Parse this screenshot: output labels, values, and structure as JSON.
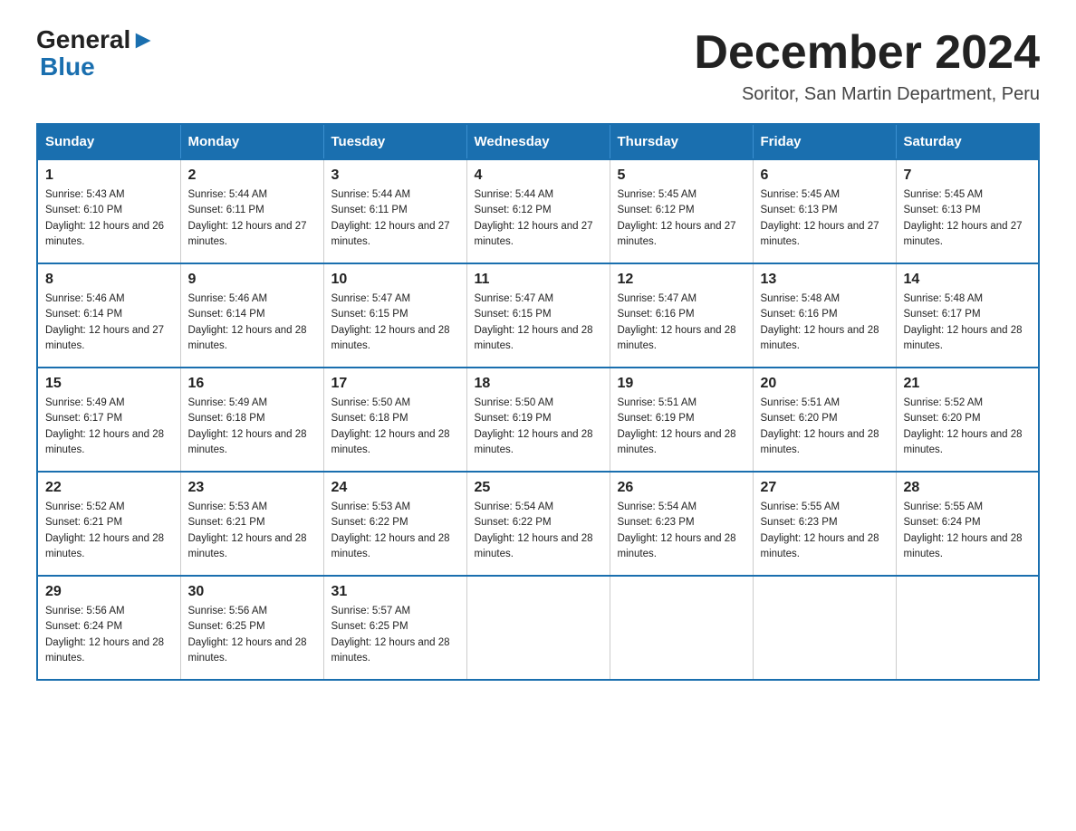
{
  "logo": {
    "text1": "General",
    "text2": "Blue"
  },
  "header": {
    "month": "December 2024",
    "location": "Soritor, San Martin Department, Peru"
  },
  "weekdays": [
    "Sunday",
    "Monday",
    "Tuesday",
    "Wednesday",
    "Thursday",
    "Friday",
    "Saturday"
  ],
  "weeks": [
    [
      {
        "day": "1",
        "sunrise": "5:43 AM",
        "sunset": "6:10 PM",
        "daylight": "12 hours and 26 minutes."
      },
      {
        "day": "2",
        "sunrise": "5:44 AM",
        "sunset": "6:11 PM",
        "daylight": "12 hours and 27 minutes."
      },
      {
        "day": "3",
        "sunrise": "5:44 AM",
        "sunset": "6:11 PM",
        "daylight": "12 hours and 27 minutes."
      },
      {
        "day": "4",
        "sunrise": "5:44 AM",
        "sunset": "6:12 PM",
        "daylight": "12 hours and 27 minutes."
      },
      {
        "day": "5",
        "sunrise": "5:45 AM",
        "sunset": "6:12 PM",
        "daylight": "12 hours and 27 minutes."
      },
      {
        "day": "6",
        "sunrise": "5:45 AM",
        "sunset": "6:13 PM",
        "daylight": "12 hours and 27 minutes."
      },
      {
        "day": "7",
        "sunrise": "5:45 AM",
        "sunset": "6:13 PM",
        "daylight": "12 hours and 27 minutes."
      }
    ],
    [
      {
        "day": "8",
        "sunrise": "5:46 AM",
        "sunset": "6:14 PM",
        "daylight": "12 hours and 27 minutes."
      },
      {
        "day": "9",
        "sunrise": "5:46 AM",
        "sunset": "6:14 PM",
        "daylight": "12 hours and 28 minutes."
      },
      {
        "day": "10",
        "sunrise": "5:47 AM",
        "sunset": "6:15 PM",
        "daylight": "12 hours and 28 minutes."
      },
      {
        "day": "11",
        "sunrise": "5:47 AM",
        "sunset": "6:15 PM",
        "daylight": "12 hours and 28 minutes."
      },
      {
        "day": "12",
        "sunrise": "5:47 AM",
        "sunset": "6:16 PM",
        "daylight": "12 hours and 28 minutes."
      },
      {
        "day": "13",
        "sunrise": "5:48 AM",
        "sunset": "6:16 PM",
        "daylight": "12 hours and 28 minutes."
      },
      {
        "day": "14",
        "sunrise": "5:48 AM",
        "sunset": "6:17 PM",
        "daylight": "12 hours and 28 minutes."
      }
    ],
    [
      {
        "day": "15",
        "sunrise": "5:49 AM",
        "sunset": "6:17 PM",
        "daylight": "12 hours and 28 minutes."
      },
      {
        "day": "16",
        "sunrise": "5:49 AM",
        "sunset": "6:18 PM",
        "daylight": "12 hours and 28 minutes."
      },
      {
        "day": "17",
        "sunrise": "5:50 AM",
        "sunset": "6:18 PM",
        "daylight": "12 hours and 28 minutes."
      },
      {
        "day": "18",
        "sunrise": "5:50 AM",
        "sunset": "6:19 PM",
        "daylight": "12 hours and 28 minutes."
      },
      {
        "day": "19",
        "sunrise": "5:51 AM",
        "sunset": "6:19 PM",
        "daylight": "12 hours and 28 minutes."
      },
      {
        "day": "20",
        "sunrise": "5:51 AM",
        "sunset": "6:20 PM",
        "daylight": "12 hours and 28 minutes."
      },
      {
        "day": "21",
        "sunrise": "5:52 AM",
        "sunset": "6:20 PM",
        "daylight": "12 hours and 28 minutes."
      }
    ],
    [
      {
        "day": "22",
        "sunrise": "5:52 AM",
        "sunset": "6:21 PM",
        "daylight": "12 hours and 28 minutes."
      },
      {
        "day": "23",
        "sunrise": "5:53 AM",
        "sunset": "6:21 PM",
        "daylight": "12 hours and 28 minutes."
      },
      {
        "day": "24",
        "sunrise": "5:53 AM",
        "sunset": "6:22 PM",
        "daylight": "12 hours and 28 minutes."
      },
      {
        "day": "25",
        "sunrise": "5:54 AM",
        "sunset": "6:22 PM",
        "daylight": "12 hours and 28 minutes."
      },
      {
        "day": "26",
        "sunrise": "5:54 AM",
        "sunset": "6:23 PM",
        "daylight": "12 hours and 28 minutes."
      },
      {
        "day": "27",
        "sunrise": "5:55 AM",
        "sunset": "6:23 PM",
        "daylight": "12 hours and 28 minutes."
      },
      {
        "day": "28",
        "sunrise": "5:55 AM",
        "sunset": "6:24 PM",
        "daylight": "12 hours and 28 minutes."
      }
    ],
    [
      {
        "day": "29",
        "sunrise": "5:56 AM",
        "sunset": "6:24 PM",
        "daylight": "12 hours and 28 minutes."
      },
      {
        "day": "30",
        "sunrise": "5:56 AM",
        "sunset": "6:25 PM",
        "daylight": "12 hours and 28 minutes."
      },
      {
        "day": "31",
        "sunrise": "5:57 AM",
        "sunset": "6:25 PM",
        "daylight": "12 hours and 28 minutes."
      },
      null,
      null,
      null,
      null
    ]
  ],
  "labels": {
    "sunrise": "Sunrise:",
    "sunset": "Sunset:",
    "daylight": "Daylight:"
  }
}
